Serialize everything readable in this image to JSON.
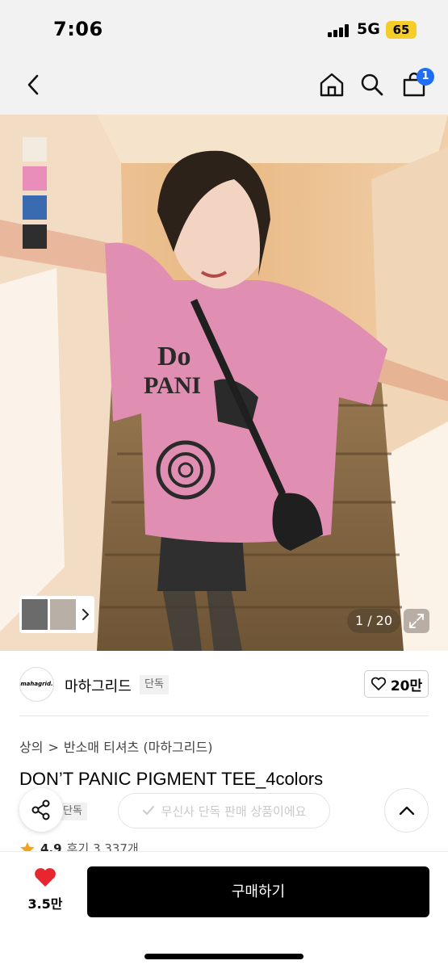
{
  "status_bar": {
    "time": "7:06",
    "network": "5G",
    "battery": "65"
  },
  "nav": {
    "cart_count": "1"
  },
  "colors": {
    "accent": "#1e6ff5",
    "heart": "#e8262f",
    "tag_bg": "#f1f1f1",
    "battery": "#f4cd2a"
  },
  "icons": [
    "back-icon",
    "home-icon",
    "search-icon",
    "cart-icon",
    "chevron-right-icon",
    "expand-icon",
    "heart-outline-icon",
    "share-icon",
    "check-icon",
    "chevron-up-icon",
    "star-icon",
    "heart-filled-icon"
  ],
  "gallery": {
    "color_swatches": [
      "#f2ebe0",
      "#e98dbb",
      "#3a6ab0",
      "#2e2e2e"
    ],
    "counter": "1 / 20"
  },
  "brand": {
    "logo_text": "mahagrid.",
    "name": "마하그리드",
    "tag": "단독",
    "like_count": "20만"
  },
  "breadcrumb": [
    "상의",
    ">",
    "반소매 티셔츠 (마하그리드)"
  ],
  "product": {
    "title": "DON’T PANIC PIGMENT TEE_4colors",
    "tag_partial": "단독",
    "exclusive_text": "무신사 단독 판매 상품이에요",
    "rating": "4.9",
    "review_text": "후기 3,337개"
  },
  "bottom_bar": {
    "wish_count": "3.5만",
    "buy_label": "구매하기"
  }
}
